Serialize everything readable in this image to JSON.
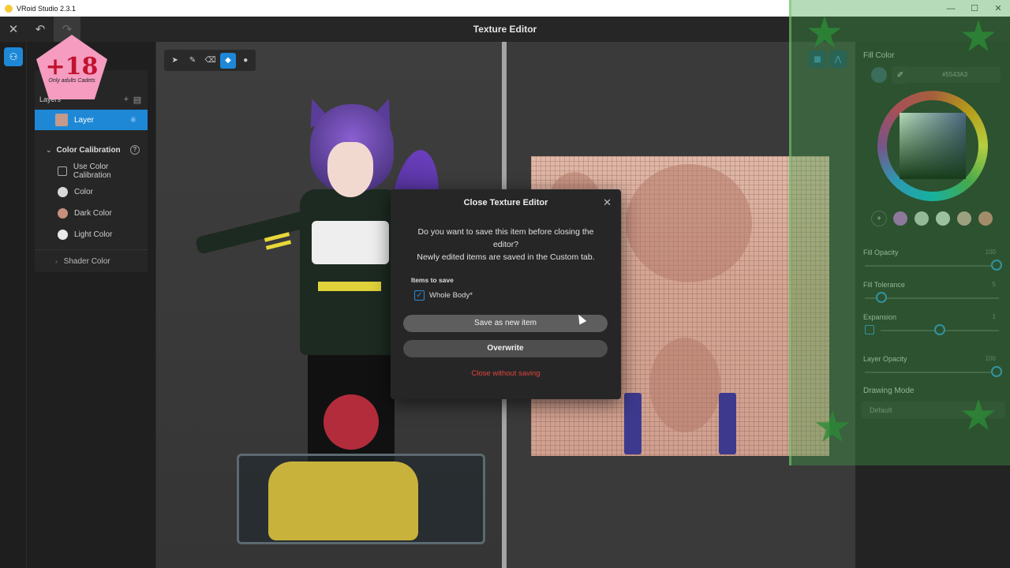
{
  "os_titlebar": {
    "title": "VRoid Studio 2.3.1",
    "controls": [
      "—",
      "☐",
      "✕"
    ]
  },
  "header": {
    "title": "Texture Editor",
    "close_glyph": "✕",
    "undo_glyph": "↶",
    "redo_glyph": "↷"
  },
  "badge": {
    "big": "+18",
    "small": "Only adults Cadets"
  },
  "layers": {
    "title": "Layers",
    "add_glyph": "+",
    "folder_glyph": "▤",
    "layer_name": "Layer"
  },
  "color_calibration": {
    "title": "Color Calibration",
    "use_label": "Use Color Calibration",
    "items": [
      {
        "label": "Color",
        "swatch": "#d8d8d8"
      },
      {
        "label": "Dark Color",
        "swatch": "#c7907c"
      },
      {
        "label": "Light Color",
        "swatch": "#e8e8e8"
      }
    ],
    "shader_label": "Shader Color"
  },
  "tools": [
    {
      "name": "select-tool",
      "glyph": "➤"
    },
    {
      "name": "pen-tool",
      "glyph": "✎"
    },
    {
      "name": "eraser-tool",
      "glyph": "⌫"
    },
    {
      "name": "fill-tool",
      "glyph": "◆"
    },
    {
      "name": "dropper-tool",
      "glyph": "●"
    }
  ],
  "right_panel": {
    "fill_color_label": "Fill Color",
    "hex": "#5543A3",
    "accent": "#5543A3",
    "swatches": [
      "#c05fd0",
      "#c9c9c9",
      "#d6d6d6",
      "#d9a0a0",
      "#e08080"
    ],
    "add_glyph": "+",
    "fill_opacity_label": "Fill Opacity",
    "fill_opacity_value": "100",
    "fill_tolerance_label": "Fill Tolerance",
    "fill_tolerance_value": "5",
    "expansion_label": "Expansion",
    "expansion_value": "1",
    "layer_opacity_label": "Layer Opacity",
    "layer_opacity_value": "100",
    "drawing_mode_label": "Drawing Mode",
    "drawing_mode_value": "Default"
  },
  "modal": {
    "title": "Close Texture Editor",
    "close_glyph": "✕",
    "message_line1": "Do you want to save this item before closing the editor?",
    "message_line2": "Newly edited items are saved in the Custom tab.",
    "items_label": "Items to save",
    "item_name": "Whole Body*",
    "item_checked": "✓",
    "save_new_label": "Save as new item",
    "overwrite_label": "Overwrite",
    "close_without_saving_label": "Close without saving"
  }
}
